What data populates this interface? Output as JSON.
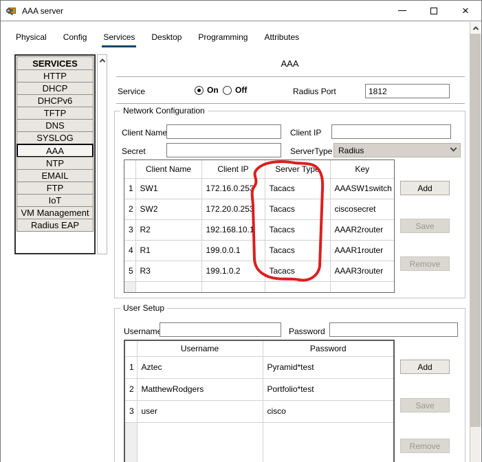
{
  "window": {
    "title": "AAA server"
  },
  "tabs": [
    {
      "label": "Physical",
      "active": false
    },
    {
      "label": "Config",
      "active": false
    },
    {
      "label": "Services",
      "active": true
    },
    {
      "label": "Desktop",
      "active": false
    },
    {
      "label": "Programming",
      "active": false
    },
    {
      "label": "Attributes",
      "active": false
    }
  ],
  "sidebar": {
    "header": "SERVICES",
    "items": [
      "HTTP",
      "DHCP",
      "DHCPv6",
      "TFTP",
      "DNS",
      "SYSLOG",
      "AAA",
      "NTP",
      "EMAIL",
      "FTP",
      "IoT",
      "VM Management",
      "Radius EAP"
    ],
    "selected": "AAA"
  },
  "aaa": {
    "page_title": "AAA",
    "service_label": "Service",
    "on_label": "On",
    "off_label": "Off",
    "selected_service_state": "On",
    "radius_port_label": "Radius Port",
    "radius_port_value": "1812",
    "network": {
      "group_title": "Network Configuration",
      "client_name_label": "Client Name",
      "client_name_value": "",
      "client_ip_label": "Client IP",
      "client_ip_value": "",
      "secret_label": "Secret",
      "secret_value": "",
      "server_type_label": "ServerType",
      "server_type_value": "Radius",
      "columns": [
        "Client Name",
        "Client IP",
        "Server Type",
        "Key"
      ],
      "rows": [
        {
          "num": "1",
          "client_name": "SW1",
          "client_ip": "172.16.0.253",
          "server_type": "Tacacs",
          "key": "AAASW1switch"
        },
        {
          "num": "2",
          "client_name": "SW2",
          "client_ip": "172.20.0.253",
          "server_type": "Tacacs",
          "key": "ciscosecret"
        },
        {
          "num": "3",
          "client_name": "R2",
          "client_ip": "192.168.10.1",
          "server_type": "Tacacs",
          "key": "AAAR2router"
        },
        {
          "num": "4",
          "client_name": "R1",
          "client_ip": "199.0.0.1",
          "server_type": "Tacacs",
          "key": "AAAR1router"
        },
        {
          "num": "5",
          "client_name": "R3",
          "client_ip": "199.1.0.2",
          "server_type": "Tacacs",
          "key": "AAAR3router"
        }
      ],
      "add_label": "Add",
      "save_label": "Save",
      "remove_label": "Remove"
    },
    "user_setup": {
      "group_title": "User Setup",
      "username_label": "Username",
      "username_value": "",
      "password_label": "Password",
      "password_value": "",
      "columns": [
        "Username",
        "Password"
      ],
      "rows": [
        {
          "num": "1",
          "username": "Aztec",
          "password": "Pyramid*test"
        },
        {
          "num": "2",
          "username": "MatthewRodgers",
          "password": "Portfolio*test"
        },
        {
          "num": "3",
          "username": "user",
          "password": "cisco"
        }
      ],
      "add_label": "Add",
      "save_label": "Save",
      "remove_label": "Remove"
    }
  },
  "annotation": {
    "shape": "hand-drawn-red-circle",
    "around": "Server Type column",
    "color": "#db1f1f"
  },
  "colors": {
    "tab_underline": "#17465f",
    "annotation_red": "#db1f1f",
    "button_face": "#ebe9e4",
    "button_disabled_face": "#dbd8d1",
    "combo_face": "#d6d2cb"
  }
}
